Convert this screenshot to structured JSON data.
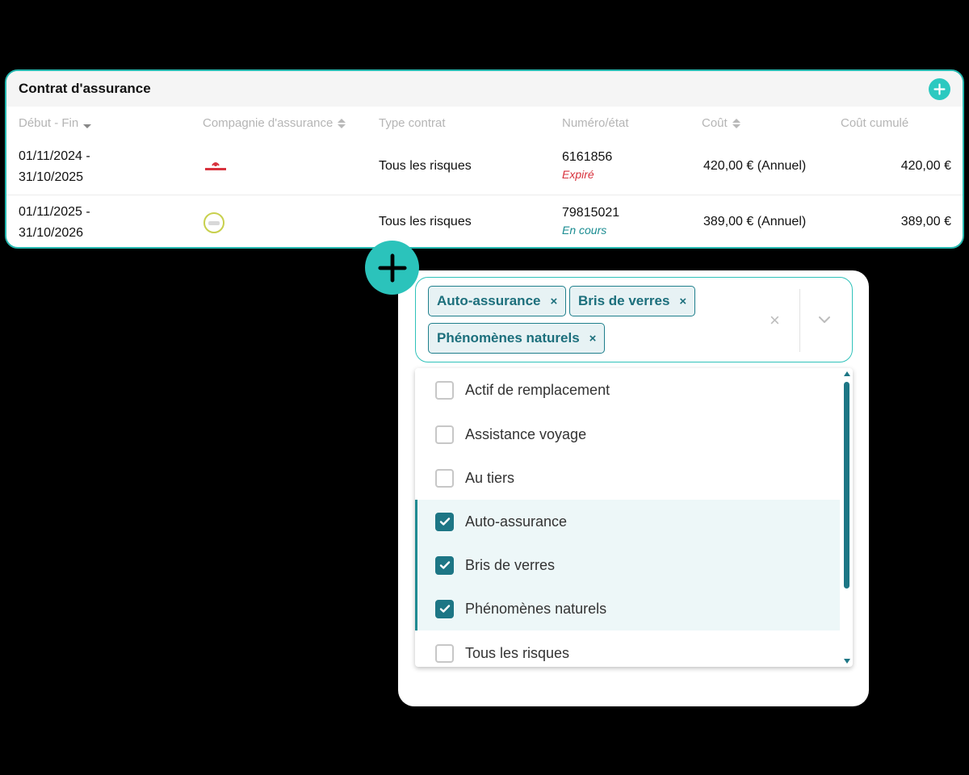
{
  "card": {
    "title": "Contrat d'assurance",
    "add_icon": "plus-circle-icon",
    "columns": [
      {
        "label": "Début - Fin",
        "sort": "desc"
      },
      {
        "label": "Compagnie d'assurance",
        "sort": "both"
      },
      {
        "label": "Type contrat",
        "sort": "none"
      },
      {
        "label": "Numéro/état",
        "sort": "none"
      },
      {
        "label": "Coût",
        "sort": "both"
      },
      {
        "label": "Coût cumulé",
        "sort": "none"
      }
    ],
    "rows": [
      {
        "start": "01/11/2024 -",
        "end": "31/10/2025",
        "company_logo": "red-brand-logo",
        "type": "Tous les risques",
        "number": "6161856",
        "state": "Expiré",
        "cost": "420,00 € (Annuel)",
        "cumul": "420,00 €"
      },
      {
        "start": "01/11/2025 -",
        "end": "31/10/2026",
        "company_logo": "ring-brand-logo",
        "type": "Tous les risques",
        "number": "79815021",
        "state": "En cours",
        "cost": "389,00 € (Annuel)",
        "cumul": "389,00 €"
      }
    ]
  },
  "select": {
    "chips": [
      "Auto-assurance",
      "Bris de verres",
      "Phénomènes naturels"
    ],
    "chip_remove": "×",
    "clear": "×",
    "options": [
      {
        "label": "Actif de remplacement",
        "checked": false
      },
      {
        "label": "Assistance voyage",
        "checked": false
      },
      {
        "label": "Au tiers",
        "checked": false
      },
      {
        "label": "Auto-assurance",
        "checked": true
      },
      {
        "label": "Bris de verres",
        "checked": true
      },
      {
        "label": "Phénomènes naturels",
        "checked": true
      },
      {
        "label": "Tous les risques",
        "checked": false
      }
    ]
  },
  "colors": {
    "accent": "#2bc3bb",
    "primary": "#1d7685",
    "expired": "#d8323d",
    "current": "#1a8c91"
  }
}
